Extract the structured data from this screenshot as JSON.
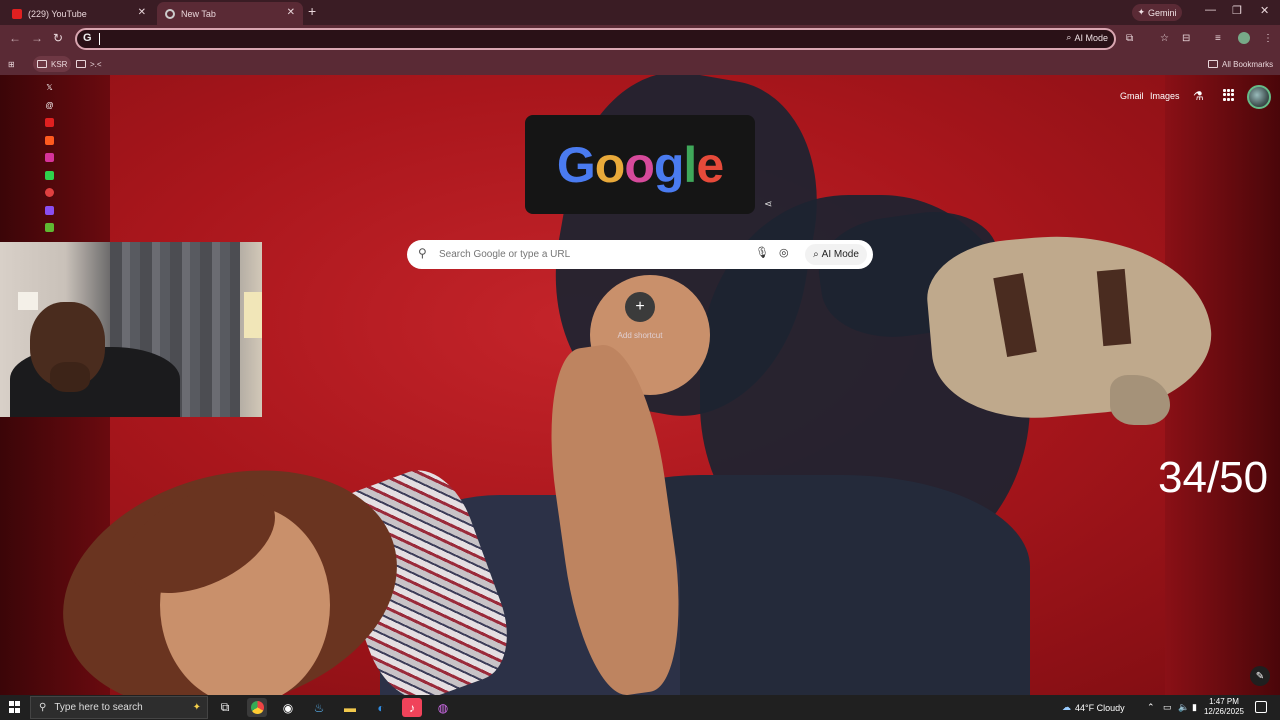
{
  "browser": {
    "tabs": [
      {
        "label": "(229) YouTube",
        "active": false
      },
      {
        "label": "New Tab",
        "active": true
      }
    ],
    "gemini_label": "Gemini",
    "omnibox": {
      "value": "",
      "ai_mode_label": "AI Mode"
    },
    "bookmarks": [
      {
        "label": "KSR"
      },
      {
        "label": ">.<"
      }
    ],
    "all_bookmarks_label": "All Bookmarks"
  },
  "newtab": {
    "logo_letters": [
      "G",
      "o",
      "o",
      "g",
      "l",
      "e"
    ],
    "search_placeholder": "Search Google or type a URL",
    "ai_mode_label": "AI Mode",
    "add_shortcut_label": "Add shortcut",
    "gmail_label": "Gmail",
    "images_label": "Images"
  },
  "overlay": {
    "counter": "34/50"
  },
  "taskbar": {
    "search_placeholder": "Type here to search",
    "weather": "44°F  Cloudy",
    "time": "1:47 PM",
    "date": "12/26/2025"
  },
  "colors": {
    "tabstrip": "#3a1c24",
    "toolbar": "#5a2a35",
    "background_red": "#a9161c",
    "taskbar": "#202020"
  }
}
